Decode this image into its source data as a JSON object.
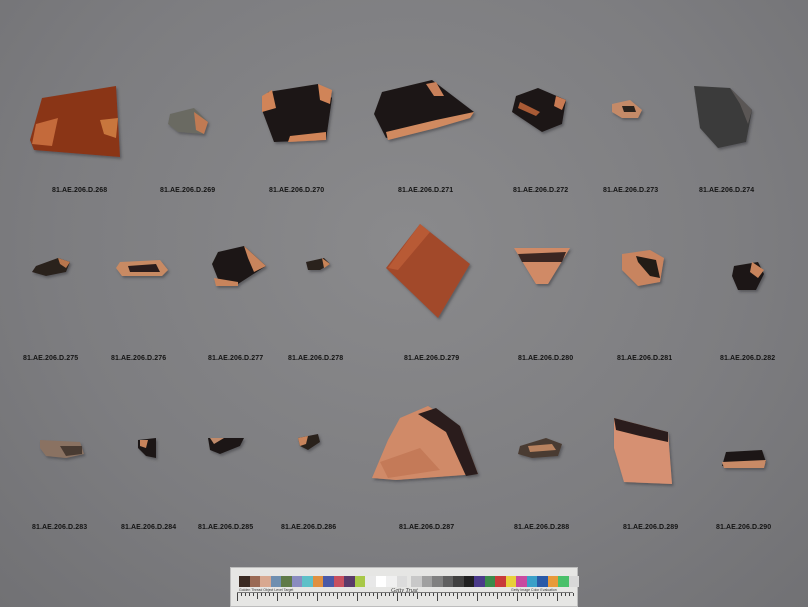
{
  "labels": [
    "81.AE.206.D.268",
    "81.AE.206.D.269",
    "81.AE.206.D.270",
    "81.AE.206.D.271",
    "81.AE.206.D.272",
    "81.AE.206.D.273",
    "81.AE.206.D.274",
    "81.AE.206.D.275",
    "81.AE.206.D.276",
    "81.AE.206.D.277",
    "81.AE.206.D.278",
    "81.AE.206.D.279",
    "81.AE.206.D.280",
    "81.AE.206.D.281",
    "81.AE.206.D.282",
    "81.AE.206.D.283",
    "81.AE.206.D.284",
    "81.AE.206.D.285",
    "81.AE.206.D.286",
    "81.AE.206.D.287",
    "81.AE.206.D.288",
    "81.AE.206.D.289",
    "81.AE.206.D.290"
  ],
  "color_card": {
    "swatches": [
      "#3a2a22",
      "#9a6a55",
      "#d8a890",
      "#6f8fb0",
      "#5f7a48",
      "#8a8cc0",
      "#5ec0c8",
      "#e09040",
      "#4a5aa8",
      "#c85060",
      "#5a3a6a",
      "#a8c848",
      "#e8e8e8",
      "#ffffff",
      "#f0f0f0",
      "#dcdcdc"
    ],
    "swatches2": [
      "#c8c8c8",
      "#a0a0a0",
      "#808080",
      "#606060",
      "#404040",
      "#202020",
      "#4a3a8a",
      "#3a8a4a",
      "#c83a3a",
      "#e8d03a",
      "#c84aa0",
      "#3aa0c8",
      "#2a5aa8",
      "#e89a3a",
      "#4ac06a",
      "#d8d8d8"
    ],
    "logo_text": "Getty Trust",
    "fine_print_left": "Golden Thread  Object Level Target",
    "fine_print_right": "Getty Image Color Evaluation"
  }
}
